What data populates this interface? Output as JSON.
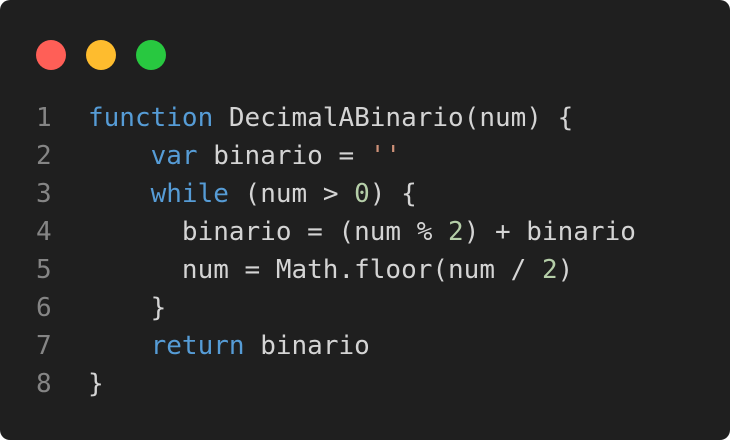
{
  "window": {
    "dots": [
      {
        "name": "close",
        "color": "#ff5f57"
      },
      {
        "name": "minimize",
        "color": "#febc2e"
      },
      {
        "name": "maximize",
        "color": "#28c840"
      }
    ]
  },
  "editor": {
    "colors": {
      "background": "#1f1f1f",
      "text": "#d4d4d4",
      "keyword": "#569cd6",
      "number": "#b5cea8",
      "string": "#ce9178",
      "line_number": "#858585"
    },
    "lines": [
      {
        "number": "1",
        "tokens": [
          {
            "t": "function",
            "c": "kw"
          },
          {
            "t": " DecimalABinario(num) {",
            "c": ""
          }
        ]
      },
      {
        "number": "2",
        "tokens": [
          {
            "t": "    ",
            "c": ""
          },
          {
            "t": "var",
            "c": "kw"
          },
          {
            "t": " binario = ",
            "c": ""
          },
          {
            "t": "''",
            "c": "str"
          }
        ]
      },
      {
        "number": "3",
        "tokens": [
          {
            "t": "    ",
            "c": ""
          },
          {
            "t": "while",
            "c": "kw"
          },
          {
            "t": " (num > ",
            "c": ""
          },
          {
            "t": "0",
            "c": "num"
          },
          {
            "t": ") {",
            "c": ""
          }
        ]
      },
      {
        "number": "4",
        "tokens": [
          {
            "t": "      binario = (num % ",
            "c": ""
          },
          {
            "t": "2",
            "c": "num"
          },
          {
            "t": ") + binario",
            "c": ""
          }
        ]
      },
      {
        "number": "5",
        "tokens": [
          {
            "t": "      num = Math.floor(num / ",
            "c": ""
          },
          {
            "t": "2",
            "c": "num"
          },
          {
            "t": ")",
            "c": ""
          }
        ]
      },
      {
        "number": "6",
        "tokens": [
          {
            "t": "    }",
            "c": ""
          }
        ]
      },
      {
        "number": "7",
        "tokens": [
          {
            "t": "    ",
            "c": ""
          },
          {
            "t": "return",
            "c": "kw"
          },
          {
            "t": " binario",
            "c": ""
          }
        ]
      },
      {
        "number": "8",
        "tokens": [
          {
            "t": "}",
            "c": ""
          }
        ]
      }
    ]
  }
}
